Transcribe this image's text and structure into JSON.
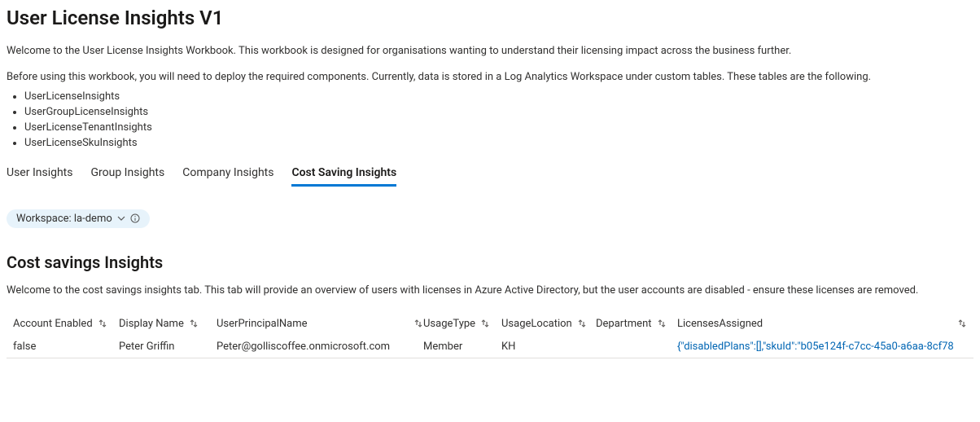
{
  "header": {
    "title": "User License Insights V1",
    "intro": "Welcome to the User License Insights Workbook. This workbook is designed for organisations wanting to understand their licensing impact across the business further.",
    "pre_list": "Before using this workbook, you will need to deploy the required components. Currently, data is stored in a Log Analytics Workspace under custom tables. These tables are the following.",
    "tables": [
      "UserLicenseInsights",
      "UserGroupLicenseInsights",
      "UserLicenseTenantInsights",
      "UserLicenseSkuInsights"
    ]
  },
  "tabs": [
    {
      "id": "user",
      "label": "User Insights",
      "active": false
    },
    {
      "id": "group",
      "label": "Group Insights",
      "active": false
    },
    {
      "id": "company",
      "label": "Company Insights",
      "active": false
    },
    {
      "id": "cost",
      "label": "Cost Saving Insights",
      "active": true
    }
  ],
  "workspace_chip": {
    "label": "Workspace: la-demo"
  },
  "section": {
    "title": "Cost savings Insights",
    "intro": "Welcome to the cost savings insights tab. This tab will provide an overview of users with licenses in Azure Active Directory, but the user accounts are disabled - ensure these licenses are removed."
  },
  "table": {
    "columns": [
      {
        "key": "account_enabled",
        "label": "Account Enabled",
        "sortable": true
      },
      {
        "key": "display_name",
        "label": "Display Name",
        "sortable": true
      },
      {
        "key": "upn",
        "label": "UserPrincipalName",
        "sortable": true
      },
      {
        "key": "usage_type",
        "label": "UsageType",
        "sortable": true
      },
      {
        "key": "usage_location",
        "label": "UsageLocation",
        "sortable": true
      },
      {
        "key": "department",
        "label": "Department",
        "sortable": true
      },
      {
        "key": "licenses",
        "label": "LicensesAssigned",
        "sortable": true
      }
    ],
    "rows": [
      {
        "account_enabled": "false",
        "display_name": "Peter Griffin",
        "upn": "Peter@golliscoffee.onmicrosoft.com",
        "usage_type": "Member",
        "usage_location": "KH",
        "department": "",
        "licenses": "{\"disabledPlans\":[],\"skuId\":\"b05e124f-c7cc-45a0-a6aa-8cf78"
      }
    ]
  }
}
